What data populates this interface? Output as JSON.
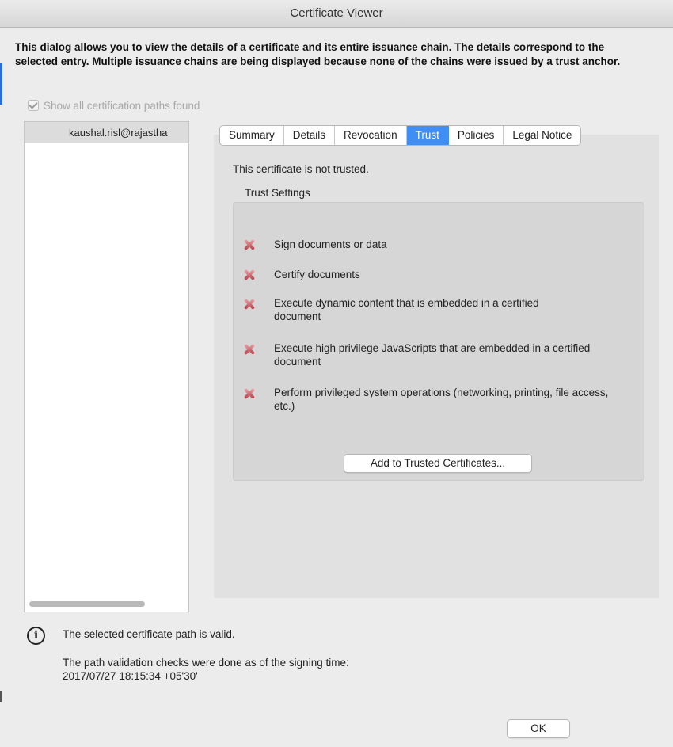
{
  "window": {
    "title": "Certificate Viewer"
  },
  "intro": {
    "text": "This dialog allows you to view the details of a certificate and its entire issuance chain. The details correspond to the selected entry. Multiple issuance chains are being displayed because none of the chains were issued by a trust anchor."
  },
  "show_all": {
    "label": "Show all certification paths found",
    "checked": true,
    "enabled": false
  },
  "cert_list": {
    "items": [
      {
        "label": "kaushal.risl@rajastha",
        "selected": true
      }
    ]
  },
  "tabs": [
    {
      "label": "Summary",
      "active": false
    },
    {
      "label": "Details",
      "active": false
    },
    {
      "label": "Revocation",
      "active": false
    },
    {
      "label": "Trust",
      "active": true
    },
    {
      "label": "Policies",
      "active": false
    },
    {
      "label": "Legal Notice",
      "active": false
    }
  ],
  "trust": {
    "status": "This certificate is not trusted.",
    "settings_label": "Trust Settings",
    "permissions": [
      {
        "text": "Sign documents or data",
        "icon": "x-icon"
      },
      {
        "text": "Certify documents",
        "icon": "x-icon"
      },
      {
        "text": "Execute dynamic content that is embedded in a certified document",
        "icon": "x-icon"
      },
      {
        "text": "Execute high privilege JavaScripts that are embedded in a certified document",
        "icon": "x-icon"
      },
      {
        "text": "Perform privileged system operations (networking, printing, file access, etc.)",
        "icon": "x-icon"
      }
    ],
    "add_button": "Add to Trusted Certificates..."
  },
  "info": {
    "icon": "info-icon",
    "valid_text": "The selected certificate path is valid.",
    "checks_text": "The path validation checks were done as of the signing time:",
    "timestamp": "2017/07/27 18:15:34 +05'30'"
  },
  "ok_button": "OK",
  "colors": {
    "accent": "#3f8ef6",
    "deny": "#b9424c"
  }
}
